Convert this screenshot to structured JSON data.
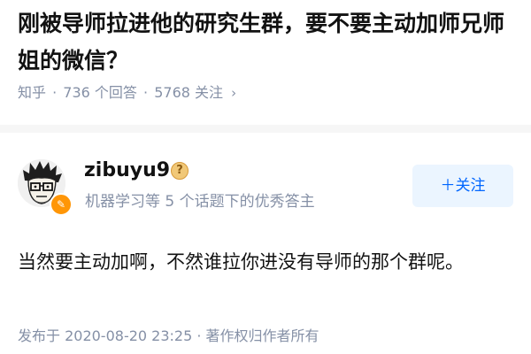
{
  "question": {
    "title": "刚被导师拉进他的研究生群，要不要主动加师兄师姐的微信？",
    "site": "知乎",
    "separator": "·",
    "answers": "736 个回答",
    "followers": "5768 关注",
    "chevron": "›"
  },
  "author": {
    "name": "zibuyu9",
    "help_icon": "question-mark-icon",
    "help_glyph": "?",
    "badge_text": "机器学习等 5 个话题下的优秀答主",
    "avatar_badge_glyph": "✎"
  },
  "follow_button": {
    "label": "＋关注"
  },
  "answer": {
    "content": "当然要主动加啊，不然谁拉你进没有导师的那个群呢。",
    "meta": "发布于 2020-08-20 23:25 · 著作权归作者所有"
  },
  "colors": {
    "accent": "#0066ff",
    "accent_bg": "#ebf5ff",
    "meta_text": "#8590a6",
    "badge": "#ff9607"
  }
}
